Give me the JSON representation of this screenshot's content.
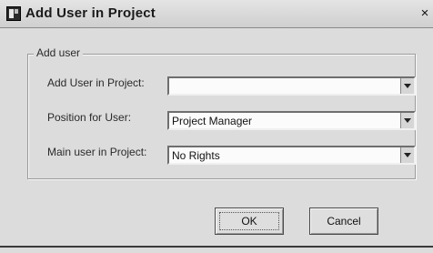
{
  "window": {
    "title": "Add User in Project",
    "icon": "app-icon",
    "close_glyph": "×"
  },
  "group": {
    "legend": "Add user"
  },
  "fields": [
    {
      "label": "Add User in Project:",
      "value": ""
    },
    {
      "label": "Position for User:",
      "value": "Project Manager"
    },
    {
      "label": "Main user in Project:",
      "value": "No Rights"
    }
  ],
  "buttons": {
    "ok_label": "OK",
    "cancel_label": "Cancel"
  }
}
